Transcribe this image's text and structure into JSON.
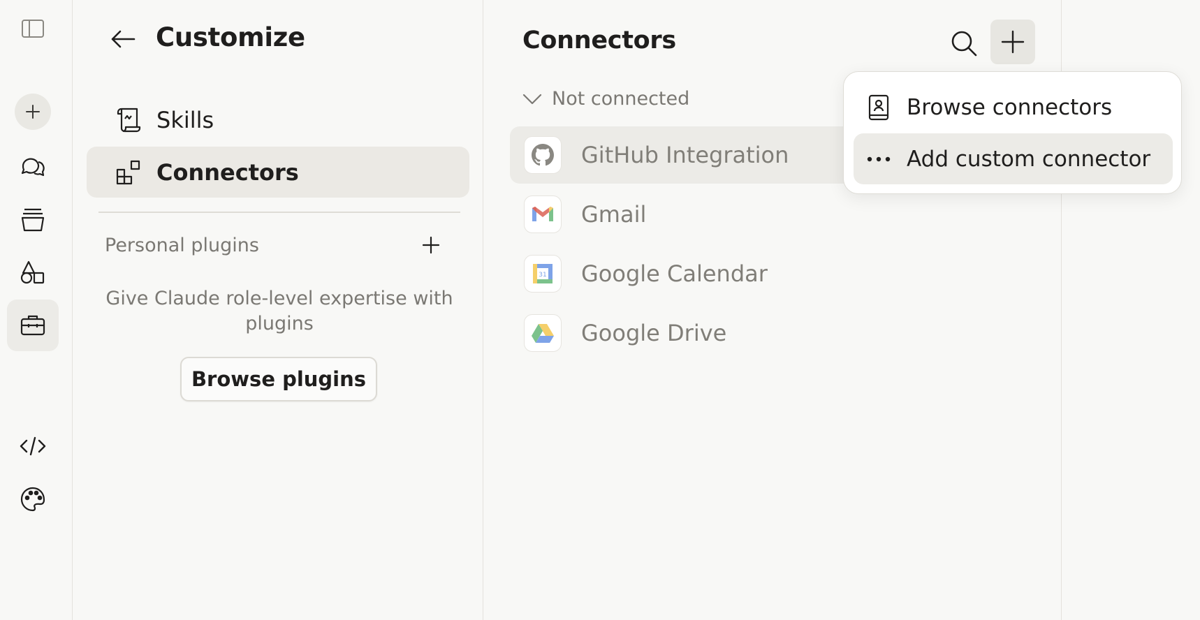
{
  "rail": {
    "icons": [
      "sidebar-toggle-icon",
      "plus-icon",
      "chats-icon",
      "projects-icon",
      "artifacts-icon",
      "toolbox-icon",
      "code-icon",
      "palette-icon"
    ]
  },
  "customize": {
    "title": "Customize",
    "nav": [
      {
        "label": "Skills",
        "icon": "scroll-icon"
      },
      {
        "label": "Connectors",
        "icon": "connectors-icon"
      }
    ],
    "personal_plugins_label": "Personal plugins",
    "plugins_description": "Give Claude role-level expertise with plugins",
    "browse_plugins_label": "Browse plugins"
  },
  "connectors": {
    "title": "Connectors",
    "section_label": "Not connected",
    "items": [
      {
        "name": "GitHub Integration",
        "icon": "github-icon"
      },
      {
        "name": "Gmail",
        "icon": "gmail-icon"
      },
      {
        "name": "Google Calendar",
        "icon": "google-calendar-icon",
        "calendar_day": "31"
      },
      {
        "name": "Google Drive",
        "icon": "google-drive-icon"
      }
    ]
  },
  "menu": {
    "items": [
      {
        "label": "Browse connectors",
        "icon": "book-icon"
      },
      {
        "label": "Add custom connector",
        "icon": "more-dots-icon"
      }
    ]
  },
  "colors": {
    "background": "#f8f8f6",
    "active_item": "#ebe9e4",
    "muted_text": "#7a7873",
    "gmail_red": "#ea4335",
    "google_blue": "#4285f4",
    "google_green": "#34a853",
    "google_yellow": "#fbbc04"
  }
}
